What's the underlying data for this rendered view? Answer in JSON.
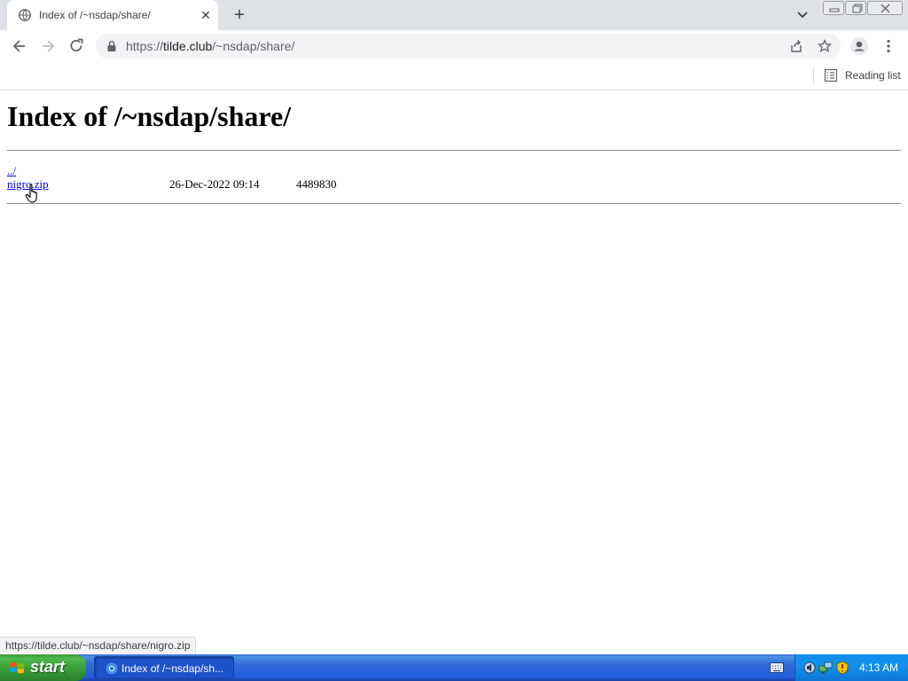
{
  "browser": {
    "tab": {
      "title": "Index of /~nsdap/share/",
      "favicon": "globe-icon",
      "close_icon": "close-icon"
    },
    "new_tab_icon": "plus-icon",
    "omnibox": {
      "scheme": "https://",
      "host": "tilde.club",
      "path": "/~nsdap/share/"
    },
    "bookmarks_bar": {
      "reading_list_label": "Reading list"
    },
    "status_url": "https://tilde.club/~nsdap/share/nigro.zip"
  },
  "page": {
    "heading": "Index of /~nsdap/share/",
    "entries": [
      {
        "name": "../",
        "date": "",
        "size": ""
      },
      {
        "name": "nigro.zip",
        "date": "26-Dec-2022 09:14",
        "size": "4489830"
      }
    ],
    "link_color": "#0000ee"
  },
  "taskbar": {
    "start_label": "start",
    "window_button_label": "Index of /~nsdap/sh...",
    "clock": "4:13 AM"
  },
  "colors": {
    "tabstrip": "#dee1e6",
    "taskbar_blue": "#245edb",
    "start_green": "#3c9a3c",
    "tray_blue": "#0f8ded"
  }
}
